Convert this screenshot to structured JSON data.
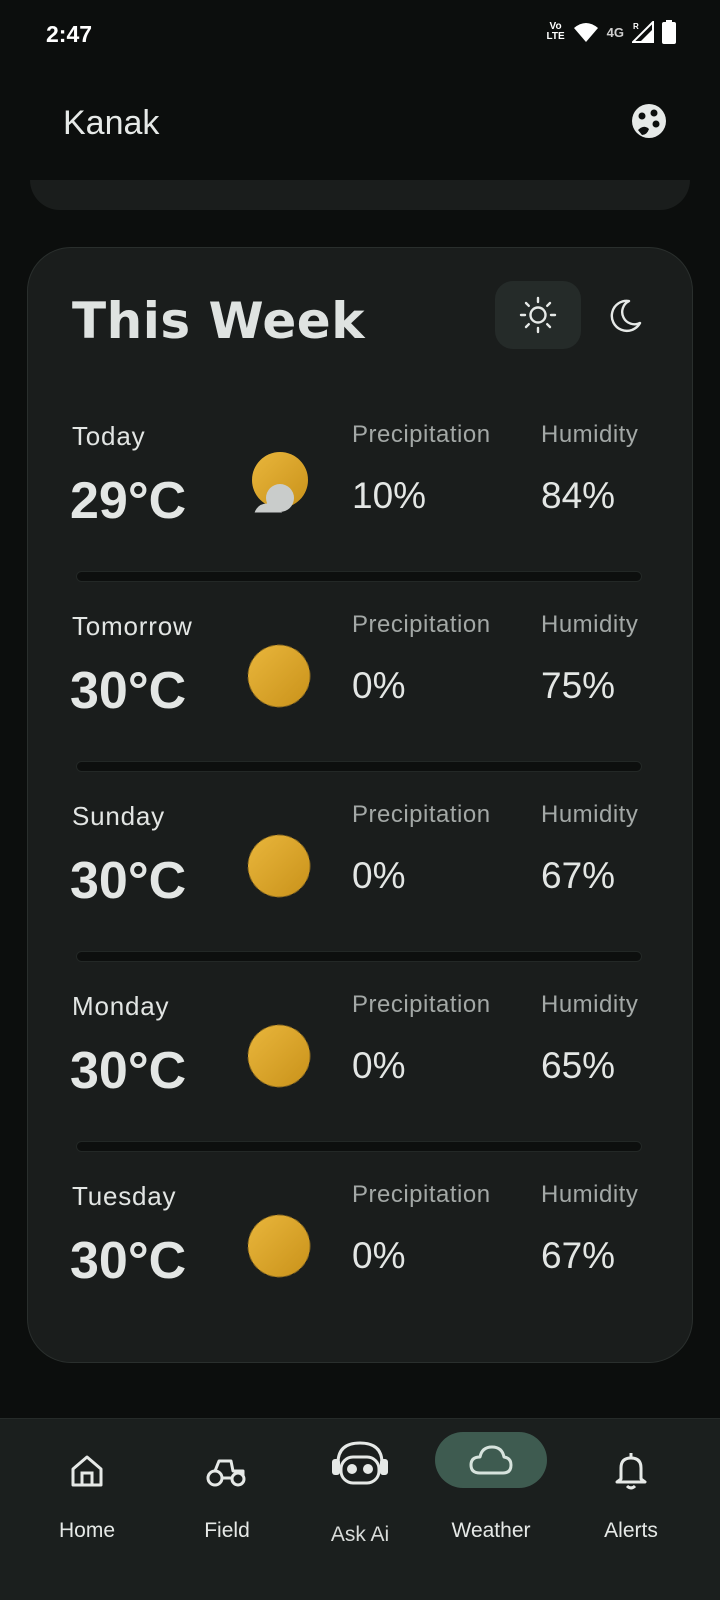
{
  "status_bar": {
    "time": "2:47",
    "volte": "Vo LTE",
    "network": "4G",
    "roaming": "R",
    "icons": [
      "volte-icon",
      "wifi-icon",
      "cell-signal-icon",
      "battery-icon"
    ]
  },
  "app_bar": {
    "title": "Kanak",
    "profile_icon": "profile-icon"
  },
  "week": {
    "title": "This Week",
    "toggles": [
      {
        "icon": "sun-icon",
        "selected": true
      },
      {
        "icon": "moon-icon",
        "selected": false
      }
    ],
    "days": [
      {
        "name": "Today",
        "temp": "29°C",
        "icon": "partly-cloudy-icon",
        "precip_label": "Precipitation",
        "precip": "10%",
        "humidity_label": "Humidity",
        "humidity": "84%"
      },
      {
        "name": "Tomorrow",
        "temp": "30°C",
        "icon": "sunny-icon",
        "precip_label": "Precipitation",
        "precip": "0%",
        "humidity_label": "Humidity",
        "humidity": "75%"
      },
      {
        "name": "Sunday",
        "temp": "30°C",
        "icon": "sunny-icon",
        "precip_label": "Precipitation",
        "precip": "0%",
        "humidity_label": "Humidity",
        "humidity": "67%"
      },
      {
        "name": "Monday",
        "temp": "30°C",
        "icon": "sunny-icon",
        "precip_label": "Precipitation",
        "precip": "0%",
        "humidity_label": "Humidity",
        "humidity": "65%"
      },
      {
        "name": "Tuesday",
        "temp": "30°C",
        "icon": "sunny-icon",
        "precip_label": "Precipitation",
        "precip": "0%",
        "humidity_label": "Humidity",
        "humidity": "67%"
      }
    ]
  },
  "nav": {
    "items": [
      {
        "label": "Home",
        "icon": "home-icon"
      },
      {
        "label": "Field",
        "icon": "tractor-icon"
      },
      {
        "label": "Ask Ai",
        "icon": "robot-icon"
      },
      {
        "label": "Weather",
        "icon": "cloud-icon",
        "active": true
      },
      {
        "label": "Alerts",
        "icon": "bell-icon"
      }
    ]
  },
  "colors": {
    "background": "#0c0e0d",
    "card": "#1a1d1c",
    "accent_pill": "#3e5b50",
    "sun": "#e0a92a"
  }
}
